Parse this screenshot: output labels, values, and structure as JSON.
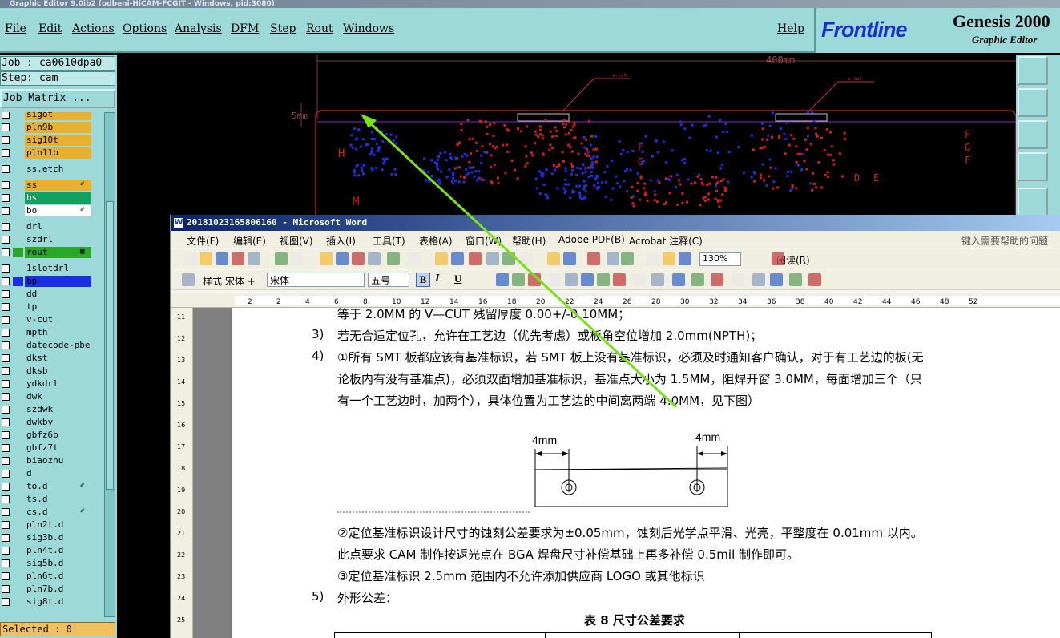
{
  "genesis": {
    "title_bar": "Graphic Editor 9.0ib2 (odbeni-HiCAM-FCGIT - Windows, pid:3080)",
    "menu": [
      "File",
      "Edit",
      "Actions",
      "Options",
      "Analysis",
      "DFM",
      "Step",
      "Rout",
      "Windows"
    ],
    "help": "Help",
    "logo": {
      "brand": "Frontline",
      "product": "Genesis 2000",
      "subtitle": "Graphic Editor"
    },
    "job": "Job : ca0610dpa0",
    "step": "Step: cam",
    "job_matrix": "Job Matrix ...",
    "selected": "Selected : 0",
    "layers": [
      {
        "name": "sigot",
        "color": "#e8b030",
        "icon": ""
      },
      {
        "name": "pln9b",
        "color": "#e8b030",
        "icon": ""
      },
      {
        "name": "sig10t",
        "color": "#e8b030",
        "icon": ""
      },
      {
        "name": "pln11b",
        "color": "#e8b030",
        "icon": ""
      },
      {
        "name": "ss.etch",
        "color": "#9ed9d9",
        "icon": ""
      },
      {
        "name": "ss",
        "color": "#e8b030",
        "icon": "✐"
      },
      {
        "name": "bs",
        "color": "#10a060",
        "icon": ""
      },
      {
        "name": "bo",
        "color": "#ffffff",
        "icon": "✐"
      },
      {
        "name": "drl",
        "color": "#9ed9d9",
        "icon": ""
      },
      {
        "name": "szdrl",
        "color": "#9ed9d9",
        "icon": ""
      },
      {
        "name": "rout",
        "color": "#2aa62a",
        "icon": "▦"
      },
      {
        "name": "1slotdrl",
        "color": "#9ed9d9",
        "icon": ""
      },
      {
        "name": "bp",
        "color": "#1a2fe0",
        "icon": ""
      },
      {
        "name": "dd",
        "color": "#9ed9d9",
        "icon": ""
      },
      {
        "name": "tp",
        "color": "#9ed9d9",
        "icon": ""
      },
      {
        "name": "v-cut",
        "color": "#9ed9d9",
        "icon": ""
      },
      {
        "name": "mpth",
        "color": "#9ed9d9",
        "icon": ""
      },
      {
        "name": "datecode-pbe",
        "color": "#9ed9d9",
        "icon": ""
      },
      {
        "name": "dkst",
        "color": "#9ed9d9",
        "icon": ""
      },
      {
        "name": "dksb",
        "color": "#9ed9d9",
        "icon": ""
      },
      {
        "name": "ydkdrl",
        "color": "#9ed9d9",
        "icon": ""
      },
      {
        "name": "dwk",
        "color": "#9ed9d9",
        "icon": ""
      },
      {
        "name": "szdwk",
        "color": "#9ed9d9",
        "icon": ""
      },
      {
        "name": "dwkby",
        "color": "#9ed9d9",
        "icon": ""
      },
      {
        "name": "gbfz6b",
        "color": "#9ed9d9",
        "icon": ""
      },
      {
        "name": "gbfz7t",
        "color": "#9ed9d9",
        "icon": ""
      },
      {
        "name": "biaozhu",
        "color": "#9ed9d9",
        "icon": ""
      },
      {
        "name": "d",
        "color": "#9ed9d9",
        "icon": ""
      },
      {
        "name": "to.d",
        "color": "#9ed9d9",
        "icon": "✐"
      },
      {
        "name": "ts.d",
        "color": "#9ed9d9",
        "icon": ""
      },
      {
        "name": "cs.d",
        "color": "#9ed9d9",
        "icon": "✐"
      },
      {
        "name": "pln2t.d",
        "color": "#9ed9d9",
        "icon": ""
      },
      {
        "name": "sig3b.d",
        "color": "#9ed9d9",
        "icon": ""
      },
      {
        "name": "pln4t.d",
        "color": "#9ed9d9",
        "icon": ""
      },
      {
        "name": "sig5b.d",
        "color": "#9ed9d9",
        "icon": ""
      },
      {
        "name": "pln6t.d",
        "color": "#9ed9d9",
        "icon": ""
      },
      {
        "name": "pln7b.d",
        "color": "#9ed9d9",
        "icon": ""
      },
      {
        "name": "sig8t.d",
        "color": "#9ed9d9",
        "icon": ""
      }
    ],
    "cad": {
      "dim_top": "400mm",
      "dim_left": "5mm",
      "vcut_label": "v-cut"
    }
  },
  "word": {
    "title": "20181023165806160 - Microsoft Word",
    "menu": [
      "文件(F)",
      "编辑(E)",
      "视图(V)",
      "插入(I)",
      "工具(T)",
      "表格(A)",
      "窗口(W)",
      "帮助(H)",
      "Adobe PDF(B)",
      "Acrobat 注释(C)"
    ],
    "help_box": "键入需要帮助的问题",
    "zoom": "130%",
    "read_mode": "阅读(R)",
    "style": "样式 宋体 +",
    "font": "宋体",
    "size": "五号",
    "ruler_numbers": [
      "2",
      "2",
      "4",
      "6",
      "8",
      "10",
      "12",
      "14",
      "16",
      "18",
      "20",
      "22",
      "24",
      "26",
      "28",
      "30",
      "32",
      "34",
      "36",
      "38",
      "40",
      "42",
      "44",
      "46",
      "48",
      "52"
    ],
    "vruler_numbers": [
      "11",
      "12",
      "13",
      "14",
      "15",
      "16",
      "17",
      "18",
      "19",
      "20",
      "21",
      "22",
      "23",
      "24",
      "25"
    ],
    "doc": {
      "line0": "等于 2.0MM 的 V—CUT 残留厚度 0.00+/-0.10MM；",
      "item3_num": "3)",
      "item3": "若无合适定位孔，允许在工艺边（优先考虑）或板角空位增加 2.0mm(NPTH)；",
      "item4_num": "4)",
      "item4_l1": "①所有 SMT 板都应该有基准标识，若 SMT 板上没有基准标识，必须及时通知客户确认，对于有工艺边的板(无",
      "item4_l2": "论板内有没有基准点)，必须双面增加基准标识，基准点大小为 1.5MM，阻焊开窗 3.0MM，每面增加三个（只",
      "item4_l3": "有一个工艺边时，加两个），具体位置为工艺边的中间离两端 4.0MM，见下图）",
      "fig_label1": "4mm",
      "fig_label2": "4mm",
      "p2_l1": "②定位基准标识设计尺寸的蚀刻公差要求为±0.05mm，蚀刻后光学点平滑、光亮，平整度在 0.01mm 以内。",
      "p2_l2": "此点要求 CAM 制作按返光点在 BGA 焊盘尺寸补偿基础上再多补偿 0.5mil 制作即可。",
      "p3": "③定位基准标识 2.5mm 范围内不允许添加供应商 LOGO 或其他标识",
      "item5_num": "5)",
      "item5": "外形公差：",
      "table_title": "表 8  尺寸公差要求"
    }
  }
}
